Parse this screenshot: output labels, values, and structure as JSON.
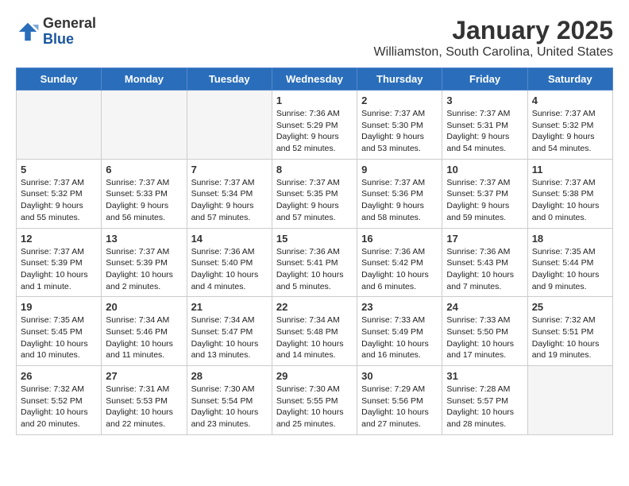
{
  "header": {
    "logo": {
      "general": "General",
      "blue": "Blue"
    },
    "title": "January 2025",
    "subtitle": "Williamston, South Carolina, United States"
  },
  "weekdays": [
    "Sunday",
    "Monday",
    "Tuesday",
    "Wednesday",
    "Thursday",
    "Friday",
    "Saturday"
  ],
  "weeks": [
    [
      {
        "day": "",
        "info": ""
      },
      {
        "day": "",
        "info": ""
      },
      {
        "day": "",
        "info": ""
      },
      {
        "day": "1",
        "info": "Sunrise: 7:36 AM\nSunset: 5:29 PM\nDaylight: 9 hours\nand 52 minutes."
      },
      {
        "day": "2",
        "info": "Sunrise: 7:37 AM\nSunset: 5:30 PM\nDaylight: 9 hours\nand 53 minutes."
      },
      {
        "day": "3",
        "info": "Sunrise: 7:37 AM\nSunset: 5:31 PM\nDaylight: 9 hours\nand 54 minutes."
      },
      {
        "day": "4",
        "info": "Sunrise: 7:37 AM\nSunset: 5:32 PM\nDaylight: 9 hours\nand 54 minutes."
      }
    ],
    [
      {
        "day": "5",
        "info": "Sunrise: 7:37 AM\nSunset: 5:32 PM\nDaylight: 9 hours\nand 55 minutes."
      },
      {
        "day": "6",
        "info": "Sunrise: 7:37 AM\nSunset: 5:33 PM\nDaylight: 9 hours\nand 56 minutes."
      },
      {
        "day": "7",
        "info": "Sunrise: 7:37 AM\nSunset: 5:34 PM\nDaylight: 9 hours\nand 57 minutes."
      },
      {
        "day": "8",
        "info": "Sunrise: 7:37 AM\nSunset: 5:35 PM\nDaylight: 9 hours\nand 57 minutes."
      },
      {
        "day": "9",
        "info": "Sunrise: 7:37 AM\nSunset: 5:36 PM\nDaylight: 9 hours\nand 58 minutes."
      },
      {
        "day": "10",
        "info": "Sunrise: 7:37 AM\nSunset: 5:37 PM\nDaylight: 9 hours\nand 59 minutes."
      },
      {
        "day": "11",
        "info": "Sunrise: 7:37 AM\nSunset: 5:38 PM\nDaylight: 10 hours\nand 0 minutes."
      }
    ],
    [
      {
        "day": "12",
        "info": "Sunrise: 7:37 AM\nSunset: 5:39 PM\nDaylight: 10 hours\nand 1 minute."
      },
      {
        "day": "13",
        "info": "Sunrise: 7:37 AM\nSunset: 5:39 PM\nDaylight: 10 hours\nand 2 minutes."
      },
      {
        "day": "14",
        "info": "Sunrise: 7:36 AM\nSunset: 5:40 PM\nDaylight: 10 hours\nand 4 minutes."
      },
      {
        "day": "15",
        "info": "Sunrise: 7:36 AM\nSunset: 5:41 PM\nDaylight: 10 hours\nand 5 minutes."
      },
      {
        "day": "16",
        "info": "Sunrise: 7:36 AM\nSunset: 5:42 PM\nDaylight: 10 hours\nand 6 minutes."
      },
      {
        "day": "17",
        "info": "Sunrise: 7:36 AM\nSunset: 5:43 PM\nDaylight: 10 hours\nand 7 minutes."
      },
      {
        "day": "18",
        "info": "Sunrise: 7:35 AM\nSunset: 5:44 PM\nDaylight: 10 hours\nand 9 minutes."
      }
    ],
    [
      {
        "day": "19",
        "info": "Sunrise: 7:35 AM\nSunset: 5:45 PM\nDaylight: 10 hours\nand 10 minutes."
      },
      {
        "day": "20",
        "info": "Sunrise: 7:34 AM\nSunset: 5:46 PM\nDaylight: 10 hours\nand 11 minutes."
      },
      {
        "day": "21",
        "info": "Sunrise: 7:34 AM\nSunset: 5:47 PM\nDaylight: 10 hours\nand 13 minutes."
      },
      {
        "day": "22",
        "info": "Sunrise: 7:34 AM\nSunset: 5:48 PM\nDaylight: 10 hours\nand 14 minutes."
      },
      {
        "day": "23",
        "info": "Sunrise: 7:33 AM\nSunset: 5:49 PM\nDaylight: 10 hours\nand 16 minutes."
      },
      {
        "day": "24",
        "info": "Sunrise: 7:33 AM\nSunset: 5:50 PM\nDaylight: 10 hours\nand 17 minutes."
      },
      {
        "day": "25",
        "info": "Sunrise: 7:32 AM\nSunset: 5:51 PM\nDaylight: 10 hours\nand 19 minutes."
      }
    ],
    [
      {
        "day": "26",
        "info": "Sunrise: 7:32 AM\nSunset: 5:52 PM\nDaylight: 10 hours\nand 20 minutes."
      },
      {
        "day": "27",
        "info": "Sunrise: 7:31 AM\nSunset: 5:53 PM\nDaylight: 10 hours\nand 22 minutes."
      },
      {
        "day": "28",
        "info": "Sunrise: 7:30 AM\nSunset: 5:54 PM\nDaylight: 10 hours\nand 23 minutes."
      },
      {
        "day": "29",
        "info": "Sunrise: 7:30 AM\nSunset: 5:55 PM\nDaylight: 10 hours\nand 25 minutes."
      },
      {
        "day": "30",
        "info": "Sunrise: 7:29 AM\nSunset: 5:56 PM\nDaylight: 10 hours\nand 27 minutes."
      },
      {
        "day": "31",
        "info": "Sunrise: 7:28 AM\nSunset: 5:57 PM\nDaylight: 10 hours\nand 28 minutes."
      },
      {
        "day": "",
        "info": ""
      }
    ]
  ]
}
